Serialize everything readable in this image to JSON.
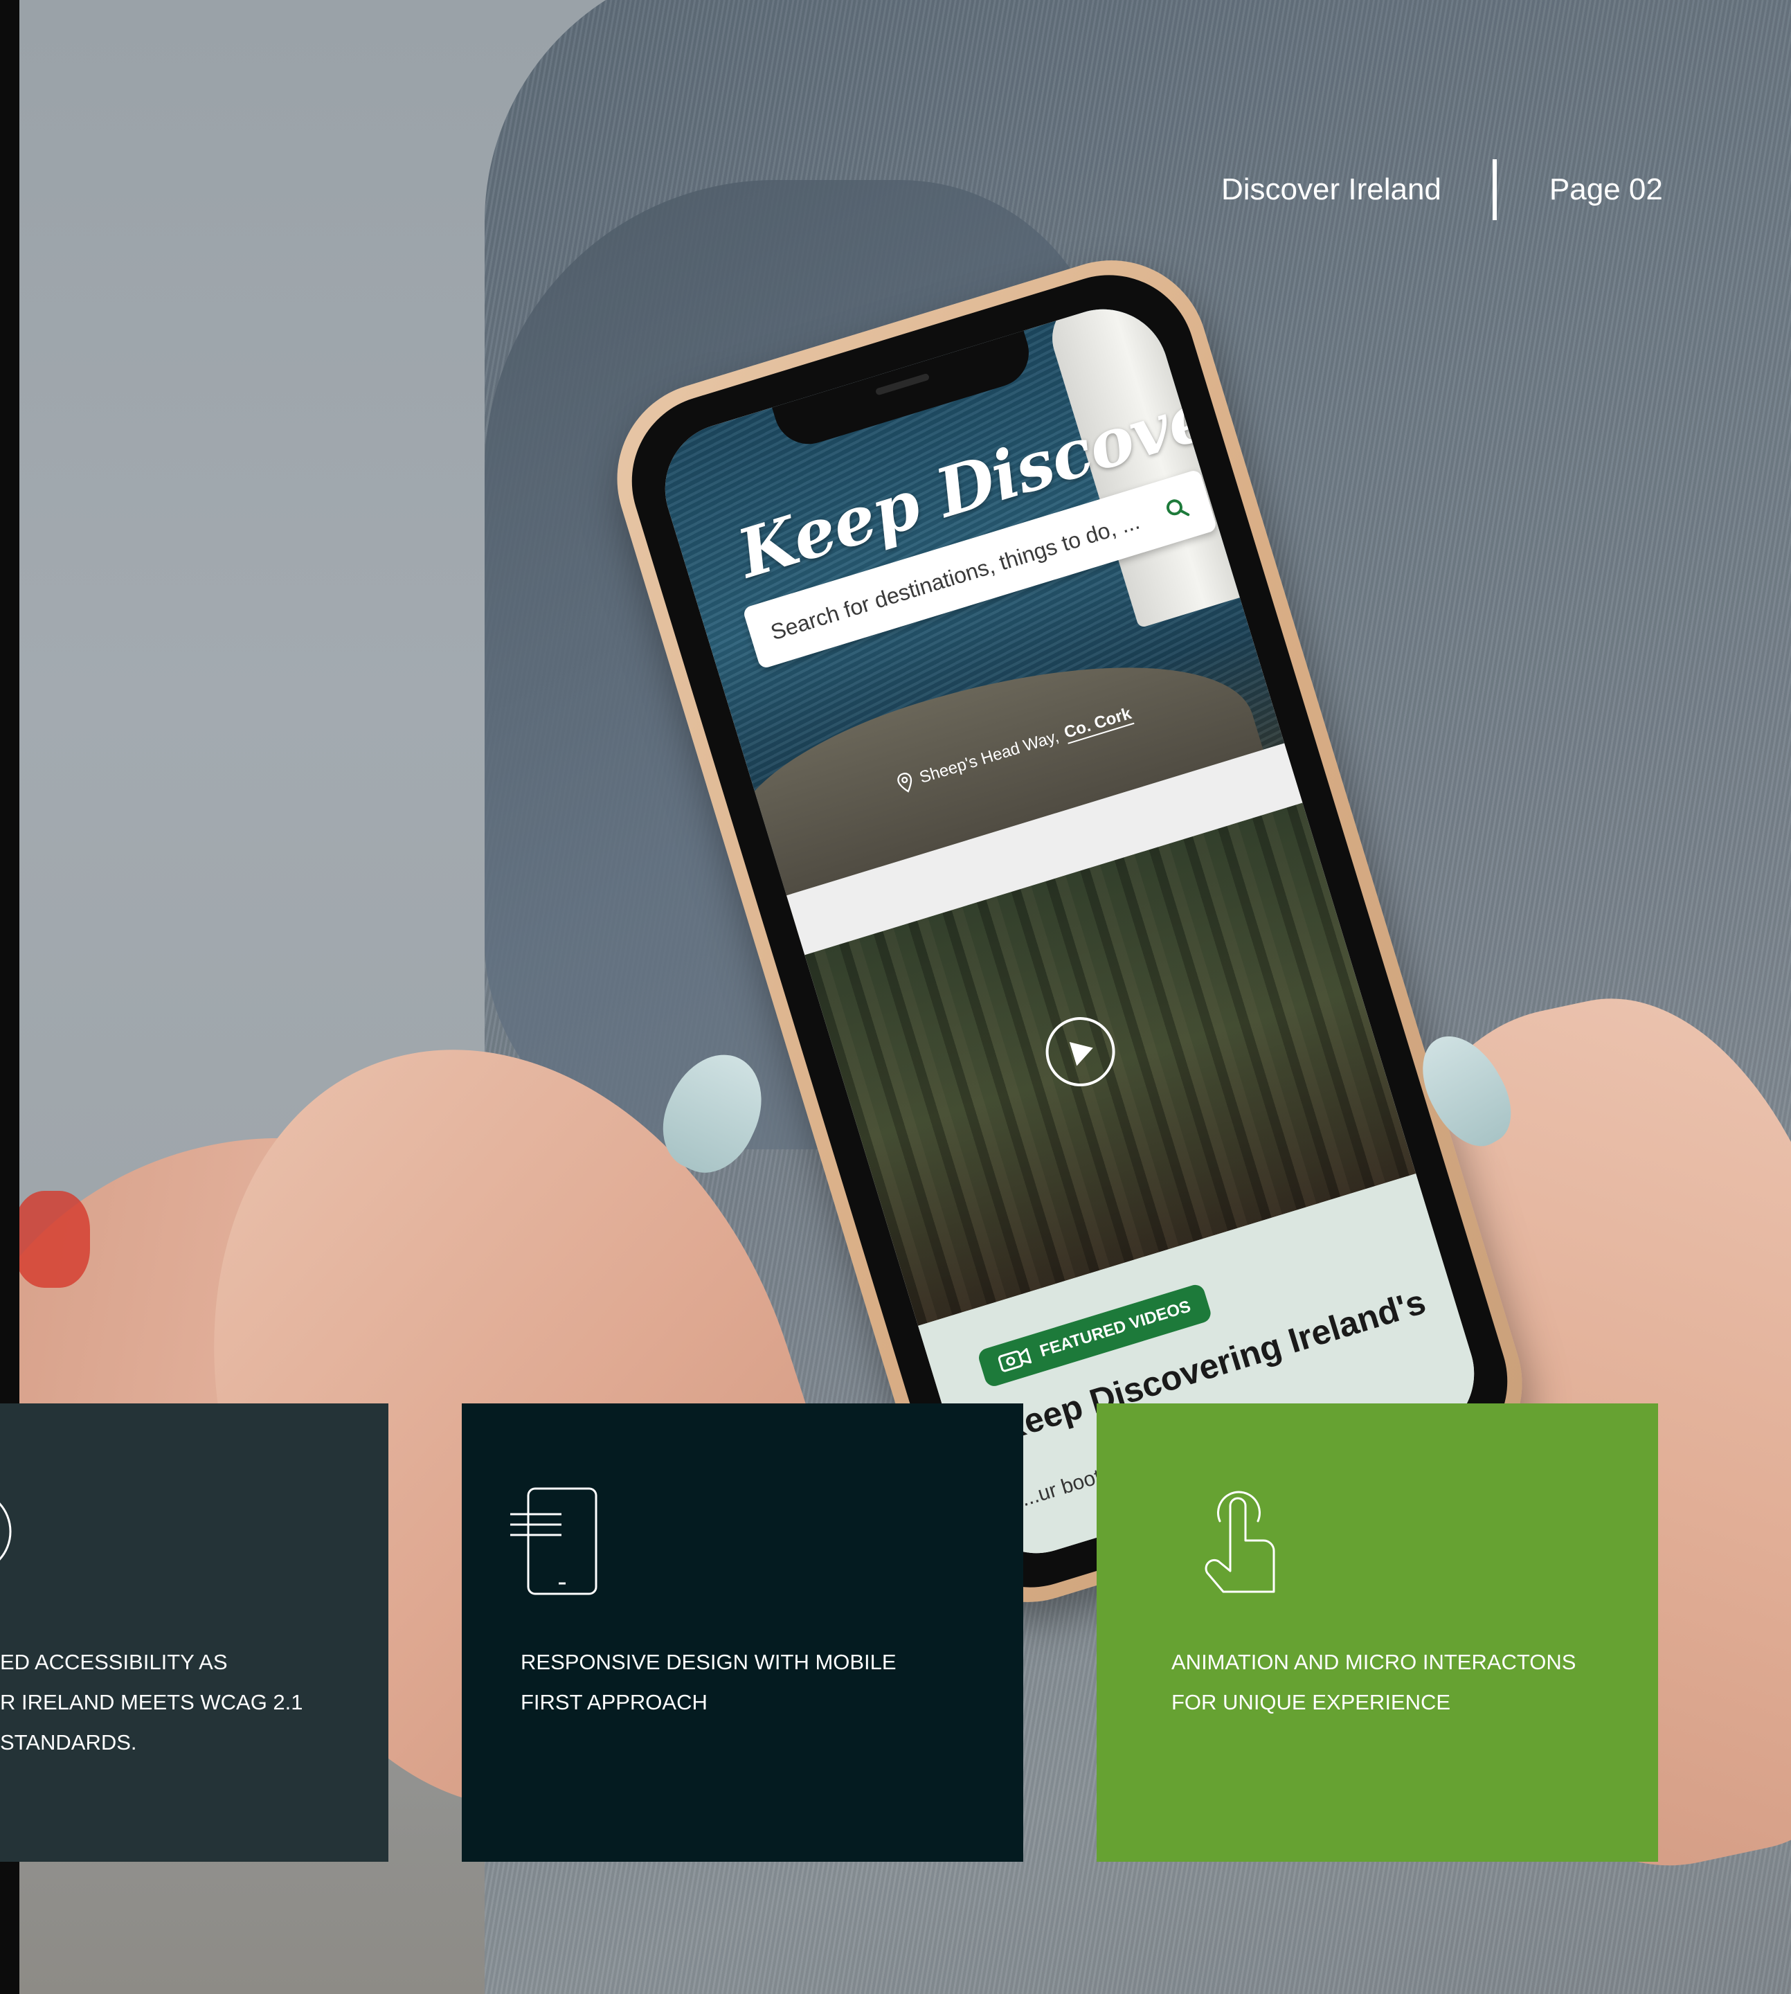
{
  "header": {
    "brand": "Discover Ireland",
    "page": "Page 02"
  },
  "phone": {
    "hero_title": "Keep Discovering",
    "search_placeholder": "Search for destinations, things to do, ...",
    "location_label": "Sheep's Head Way,",
    "location_county": "Co. Cork",
    "badge_label": "FEATURED VIDEOS",
    "article_title": "Keep Discovering Ireland's",
    "article_excerpt": "...ur boots ... walking ...ing wav..."
  },
  "cards": [
    {
      "id": "accessibility",
      "text": "ED ACCESSIBILITY AS\nR IRELAND MEETS WCAG 2.1\nSTANDARDS.",
      "icon": "accessibility-icon",
      "bg": "#243337"
    },
    {
      "id": "responsive",
      "text": "RESPONSIVE DESIGN WITH MOBILE\nFIRST APPROACH",
      "icon": "mobile-device-icon",
      "bg": "#041b20"
    },
    {
      "id": "animation",
      "text": "ANIMATION AND MICRO INTERACTONS\nFOR UNIQUE EXPERIENCE",
      "icon": "tap-gesture-icon",
      "bg": "#66a232"
    }
  ],
  "colors": {
    "brand_green": "#66a232",
    "dark_teal": "#243337",
    "deep_navy": "#041b20",
    "badge_green": "#1d7a3a"
  }
}
